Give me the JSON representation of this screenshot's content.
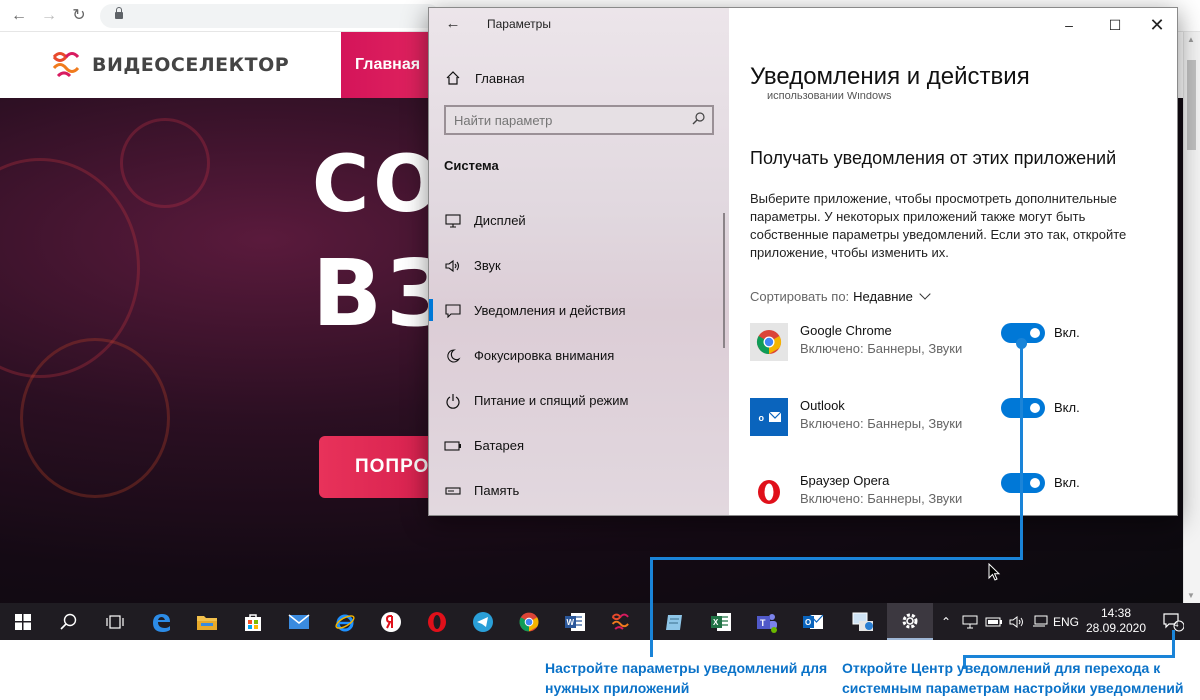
{
  "site": {
    "logo_text": "ВИДЕОСЕЛЕКТОР",
    "nav_item": "Главная",
    "hero_line1": "СО",
    "hero_line2": "ВЗ",
    "hero_button": "ПОПРО"
  },
  "settings": {
    "window_title": "Параметры",
    "home_label": "Главная",
    "search_placeholder": "Найти параметр",
    "section": "Система",
    "nav": [
      {
        "label": "Дисплей",
        "icon": "display-icon"
      },
      {
        "label": "Звук",
        "icon": "sound-icon"
      },
      {
        "label": "Уведомления и действия",
        "icon": "notifications-icon",
        "active": true
      },
      {
        "label": "Фокусировка внимания",
        "icon": "moon-icon"
      },
      {
        "label": "Питание и спящий режим",
        "icon": "power-icon"
      },
      {
        "label": "Батарея",
        "icon": "battery-icon"
      },
      {
        "label": "Память",
        "icon": "storage-icon"
      }
    ],
    "page_title": "Уведомления и действия",
    "cut_text": "использовании Windows",
    "subtitle": "Получать уведомления от этих приложений",
    "description": "Выберите приложение, чтобы просмотреть дополнительные параметры. У некоторых приложений также могут быть собственные параметры уведомлений. Если это так, откройте приложение, чтобы изменить их.",
    "sort_label": "Сортировать по:",
    "sort_value": "Недавние",
    "apps": [
      {
        "name": "Google Chrome",
        "status": "Включено: Баннеры, Звуки",
        "toggle": "Вкл.",
        "icon": "chrome-icon",
        "on": true
      },
      {
        "name": "Outlook",
        "status": "Включено: Баннеры, Звуки",
        "toggle": "Вкл.",
        "icon": "outlook-icon",
        "on": true
      },
      {
        "name": "Браузер Opera",
        "status": "Включено: Баннеры, Звуки",
        "toggle": "Вкл.",
        "icon": "opera-icon",
        "on": true
      }
    ]
  },
  "taskbar": {
    "language": "ENG",
    "time": "14:38",
    "date": "28.09.2020",
    "notification_count": "4",
    "apps": [
      "start-icon",
      "search-icon",
      "task-view-icon",
      "edge-icon",
      "file-explorer-icon",
      "store-icon",
      "mail-icon",
      "internet-explorer-icon",
      "yandex-icon",
      "opera-icon",
      "telegram-icon",
      "chrome-icon",
      "word-icon",
      "videoselector-icon",
      "notepad-icon",
      "excel-icon",
      "teams-icon",
      "outlook-icon",
      "network-manager-icon",
      "settings-icon"
    ]
  },
  "annotations": {
    "left": "Настройте параметры уведомлений для нужных приложений",
    "right": "Откройте Центр уведомлений для перехода к системным параметрам настройки уведомлений"
  },
  "colors": {
    "accent": "#0078d7",
    "annotation": "#0a72c8",
    "brand_pink": "#d4145a"
  }
}
